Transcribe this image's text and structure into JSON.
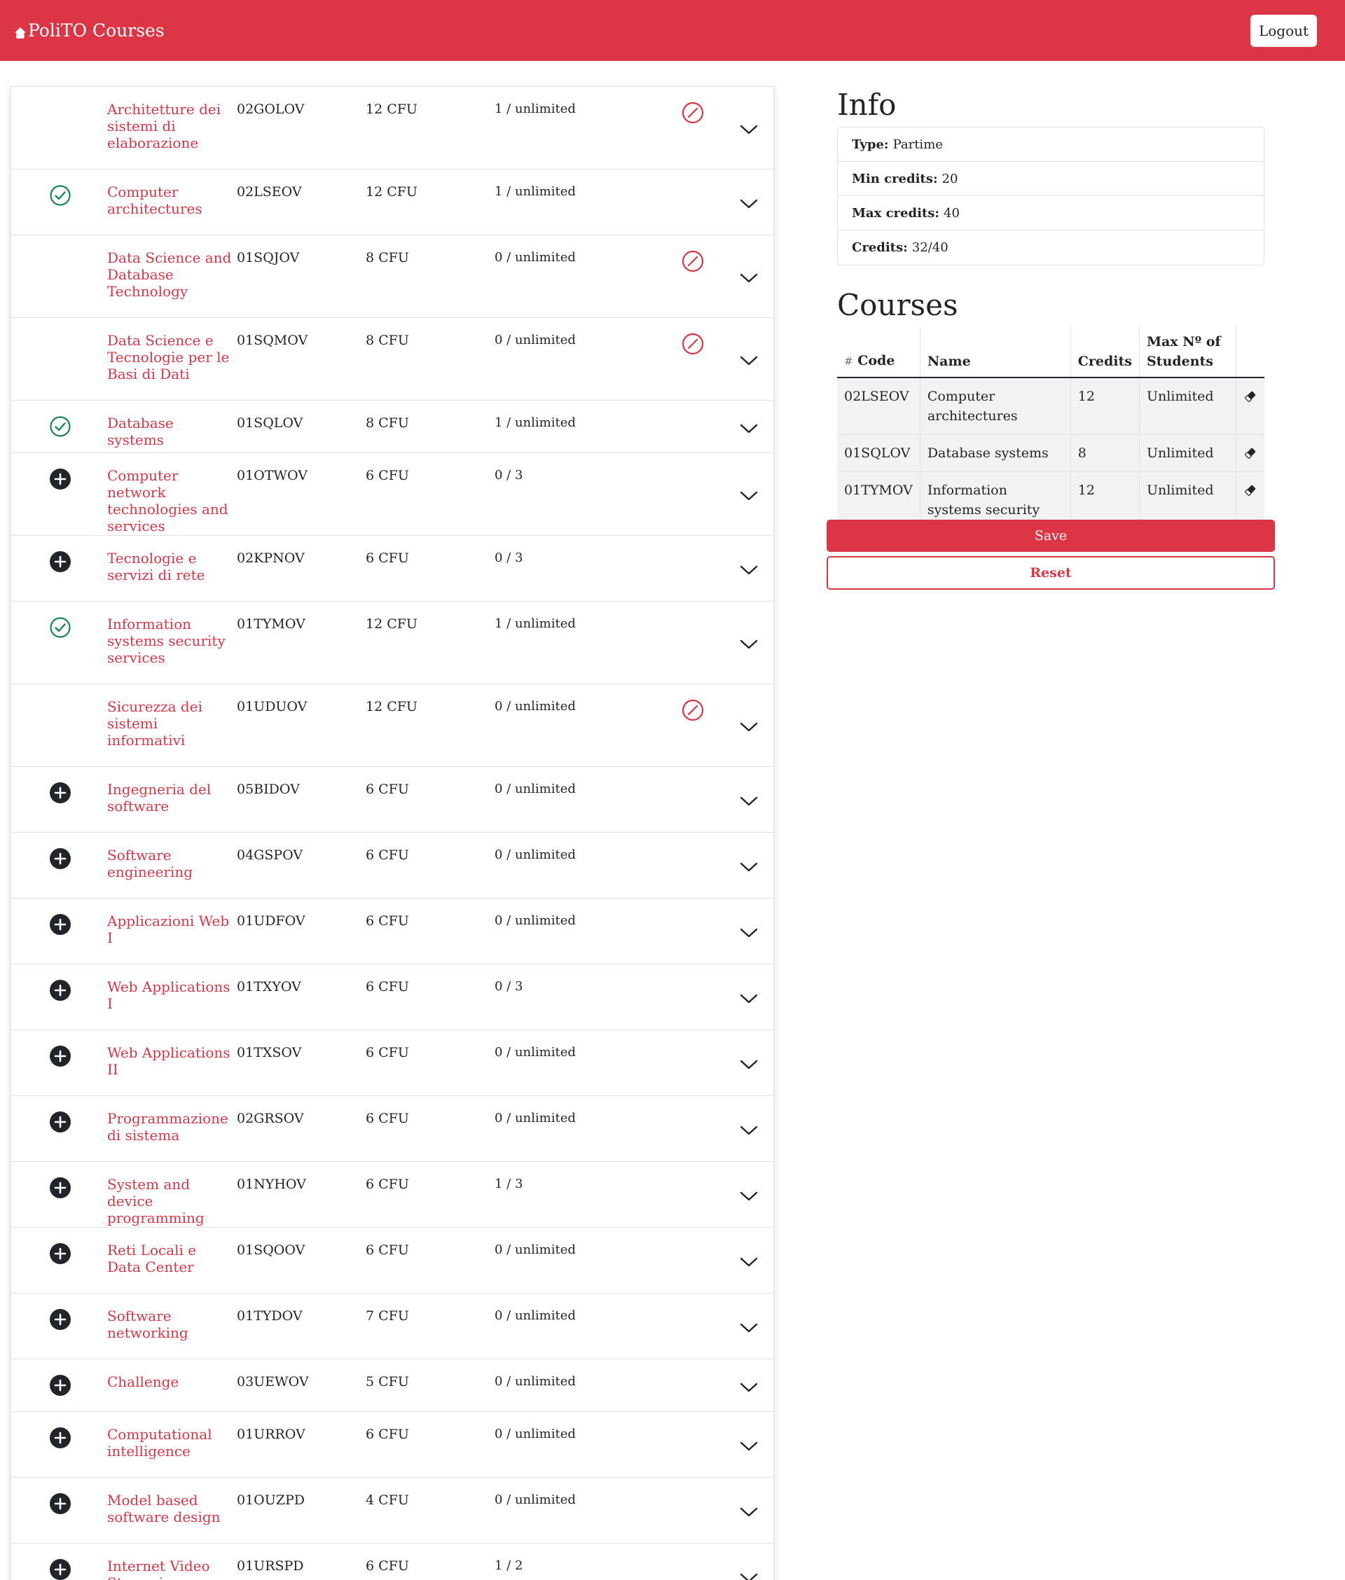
{
  "navbar": {
    "brand": "PoliTO Courses",
    "brand_icon": "house-icon",
    "logout_label": "Logout"
  },
  "colors": {
    "brand": "#dc3545",
    "added": "#198754",
    "add_icon": "#212529"
  },
  "courses": [
    {
      "name": "Architetture dei sistemi di elaborazione",
      "code": "02GOLOV",
      "credits": "12 CFU",
      "enrolled": "1 / unlimited",
      "status": "none",
      "incompatible": true
    },
    {
      "name": "Computer architectures",
      "code": "02LSEOV",
      "credits": "12 CFU",
      "enrolled": "1 / unlimited",
      "status": "added",
      "incompatible": false
    },
    {
      "name": "Data Science and Database Technology",
      "code": "01SQJOV",
      "credits": "8 CFU",
      "enrolled": "0 / unlimited",
      "status": "none",
      "incompatible": true
    },
    {
      "name": "Data Science e Tecnologie per le Basi di Dati",
      "code": "01SQMOV",
      "credits": "8 CFU",
      "enrolled": "0 / unlimited",
      "status": "none",
      "incompatible": true
    },
    {
      "name": "Database systems",
      "code": "01SQLOV",
      "credits": "8 CFU",
      "enrolled": "1 / unlimited",
      "status": "added",
      "incompatible": false
    },
    {
      "name": "Computer network technologies and services",
      "code": "01OTWOV",
      "credits": "6 CFU",
      "enrolled": "0 / 3",
      "status": "add",
      "incompatible": false
    },
    {
      "name": "Tecnologie e servizi di rete",
      "code": "02KPNOV",
      "credits": "6 CFU",
      "enrolled": "0 / 3",
      "status": "add",
      "incompatible": false
    },
    {
      "name": "Information systems security services",
      "code": "01TYMOV",
      "credits": "12 CFU",
      "enrolled": "1 / unlimited",
      "status": "added",
      "incompatible": false
    },
    {
      "name": "Sicurezza dei sistemi informativi",
      "code": "01UDUOV",
      "credits": "12 CFU",
      "enrolled": "0 / unlimited",
      "status": "none",
      "incompatible": true
    },
    {
      "name": "Ingegneria del software",
      "code": "05BIDOV",
      "credits": "6 CFU",
      "enrolled": "0 / unlimited",
      "status": "add",
      "incompatible": false
    },
    {
      "name": "Software engineering",
      "code": "04GSPOV",
      "credits": "6 CFU",
      "enrolled": "0 / unlimited",
      "status": "add",
      "incompatible": false
    },
    {
      "name": "Applicazioni Web I",
      "code": "01UDFOV",
      "credits": "6 CFU",
      "enrolled": "0 / unlimited",
      "status": "add",
      "incompatible": false
    },
    {
      "name": "Web Applications I",
      "code": "01TXYOV",
      "credits": "6 CFU",
      "enrolled": "0 / 3",
      "status": "add",
      "incompatible": false
    },
    {
      "name": "Web Applications II",
      "code": "01TXSOV",
      "credits": "6 CFU",
      "enrolled": "0 / unlimited",
      "status": "add",
      "incompatible": false
    },
    {
      "name": "Programmazione di sistema",
      "code": "02GRSOV",
      "credits": "6 CFU",
      "enrolled": "0 / unlimited",
      "status": "add",
      "incompatible": false
    },
    {
      "name": "System and device programming",
      "code": "01NYHOV",
      "credits": "6 CFU",
      "enrolled": "1 / 3",
      "status": "add",
      "incompatible": false
    },
    {
      "name": "Reti Locali e Data Center",
      "code": "01SQOOV",
      "credits": "6 CFU",
      "enrolled": "0 / unlimited",
      "status": "add",
      "incompatible": false
    },
    {
      "name": "Software networking",
      "code": "01TYDOV",
      "credits": "7 CFU",
      "enrolled": "0 / unlimited",
      "status": "add",
      "incompatible": false
    },
    {
      "name": "Challenge",
      "code": "03UEWOV",
      "credits": "5 CFU",
      "enrolled": "0 / unlimited",
      "status": "add",
      "incompatible": false
    },
    {
      "name": "Computational intelligence",
      "code": "01URROV",
      "credits": "6 CFU",
      "enrolled": "0 / unlimited",
      "status": "add",
      "incompatible": false
    },
    {
      "name": "Model based software design",
      "code": "01OUZPD",
      "credits": "4 CFU",
      "enrolled": "0 / unlimited",
      "status": "add",
      "incompatible": false
    },
    {
      "name": "Internet Video Streaming",
      "code": "01URSPD",
      "credits": "6 CFU",
      "enrolled": "1 / 2",
      "status": "add",
      "incompatible": false
    }
  ],
  "info": {
    "title": "Info",
    "type_label": "Type:",
    "type_value": "Partime",
    "min_label": "Min credits:",
    "min_value": "20",
    "max_label": "Max credits:",
    "max_value": "40",
    "credits_label": "Credits:",
    "credits_value": "32/40"
  },
  "plan": {
    "title": "Courses",
    "headers": {
      "hash": "#",
      "code": "Code",
      "name": "Name",
      "credits": "Credits",
      "max_students": "Max Nº of Students"
    },
    "rows": [
      {
        "code": "02LSEOV",
        "name": "Computer architectures",
        "credits": "12",
        "max": "Unlimited"
      },
      {
        "code": "01SQLOV",
        "name": "Database systems",
        "credits": "8",
        "max": "Unlimited"
      },
      {
        "code": "01TYMOV",
        "name": "Information systems security services",
        "credits": "12",
        "max": "Unlimited"
      }
    ],
    "delete_icon": "eraser-icon"
  },
  "actions": {
    "save_label": "Save",
    "reset_label": "Reset"
  }
}
